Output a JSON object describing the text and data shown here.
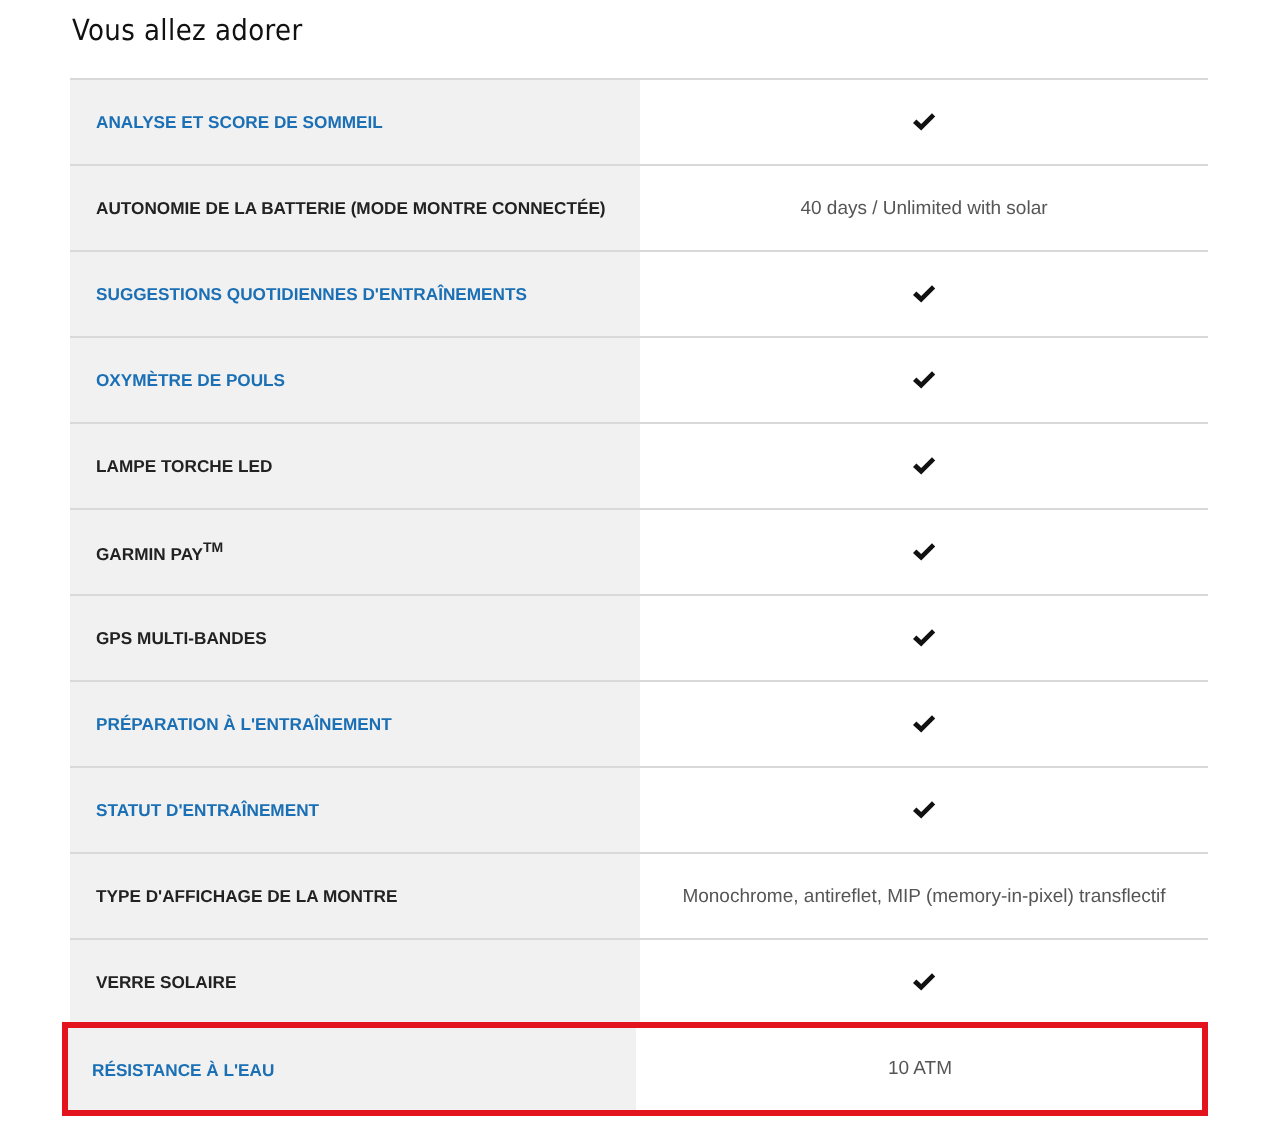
{
  "title": "Vous allez adorer",
  "rows": [
    {
      "label": "ANALYSE ET SCORE DE SOMMEIL",
      "link": true,
      "value": {
        "kind": "check"
      },
      "highlighted": false
    },
    {
      "label": "AUTONOMIE DE LA BATTERIE (MODE MONTRE CONNECTÉE)",
      "link": false,
      "value": {
        "kind": "text",
        "text": "40 days / Unlimited with solar"
      },
      "highlighted": false
    },
    {
      "label": "SUGGESTIONS QUOTIDIENNES D'ENTRAÎNEMENTS",
      "link": true,
      "value": {
        "kind": "check"
      },
      "highlighted": false
    },
    {
      "label": "OXYMÈTRE DE POULS",
      "link": true,
      "value": {
        "kind": "check"
      },
      "highlighted": false
    },
    {
      "label": "LAMPE TORCHE LED",
      "link": false,
      "value": {
        "kind": "check"
      },
      "highlighted": false
    },
    {
      "label": "GARMIN PAY$^{TM}$",
      "link": false,
      "value": {
        "kind": "check"
      },
      "highlighted": false
    },
    {
      "label": "GPS MULTI-BANDES",
      "link": false,
      "value": {
        "kind": "check"
      },
      "highlighted": false
    },
    {
      "label": "PRÉPARATION À L'ENTRAÎNEMENT",
      "link": true,
      "value": {
        "kind": "check"
      },
      "highlighted": false
    },
    {
      "label": "STATUT D'ENTRAÎNEMENT",
      "link": true,
      "value": {
        "kind": "check"
      },
      "highlighted": false
    },
    {
      "label": "TYPE D'AFFICHAGE DE LA MONTRE",
      "link": false,
      "value": {
        "kind": "text",
        "text": "Monochrome, antireflet, MIP (memory-in-pixel) transflectif"
      },
      "highlighted": false
    },
    {
      "label": "VERRE SOLAIRE",
      "link": false,
      "value": {
        "kind": "check"
      },
      "highlighted": false
    },
    {
      "label": "RÉSISTANCE À L'EAU",
      "link": true,
      "value": {
        "kind": "text",
        "text": "10 ATM"
      },
      "highlighted": true
    }
  ]
}
